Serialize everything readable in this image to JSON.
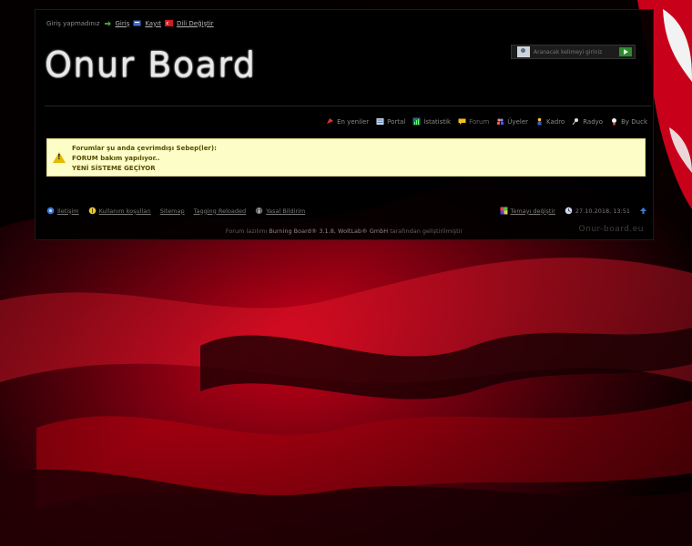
{
  "userbar": {
    "prompt": "Giriş yapmadınız",
    "login": "Giriş",
    "register": "Kayıt",
    "language": "Dili Değiştir"
  },
  "logo": {
    "text": "Onur Board"
  },
  "search": {
    "placeholder": "Aranacak kelimeyi giriniz"
  },
  "nav": {
    "items": [
      {
        "label": "En yeniler",
        "icon": "new-posts-icon"
      },
      {
        "label": "Portal",
        "icon": "portal-icon"
      },
      {
        "label": "İstatistik",
        "icon": "statistics-icon"
      },
      {
        "label": "Forum",
        "icon": "forum-icon"
      },
      {
        "label": "Üyeler",
        "icon": "members-icon"
      },
      {
        "label": "Kadro",
        "icon": "staff-icon"
      },
      {
        "label": "Radyo",
        "icon": "radio-icon"
      },
      {
        "label": "By Duck",
        "icon": "duck-icon"
      }
    ]
  },
  "notice": {
    "title": "Forumlar şu anda çevrimdışı Sebep(ler):",
    "line1": "FORUM bakım yapılıyor..",
    "line2": "YENİ SİSTEME GEÇİYOR"
  },
  "footer": {
    "left": [
      {
        "label": "İletişim",
        "icon": "contact-icon"
      },
      {
        "label": "Kullanım koşulları",
        "icon": "terms-icon"
      },
      {
        "label": "Sitemap",
        "icon": ""
      },
      {
        "label": "Tagging Reloaded",
        "icon": ""
      },
      {
        "label": "Yasal Bildirim",
        "icon": "legal-icon"
      }
    ],
    "theme": "Temayı değiştir",
    "datetime": "27.10.2018, 13:51"
  },
  "copyright": {
    "prefix": "Forum lazılımı",
    "product": "Burning Board® 3.1.8,",
    "company": "WoltLab® GmbH",
    "suffix": "tarafından geliştirilmiştir"
  },
  "domain": "Onur-board.eu",
  "colors": {
    "notice_bg": "#fdfdc8",
    "notice_text": "#564d00",
    "accent_red": "#c8001a"
  }
}
